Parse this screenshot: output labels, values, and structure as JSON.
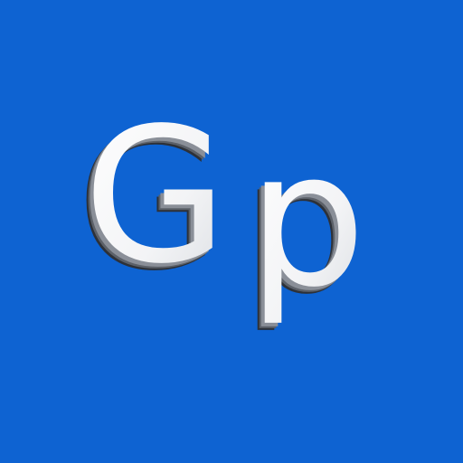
{
  "app_icon": {
    "name": "Gp",
    "letters": [
      "G",
      "p"
    ],
    "colors": {
      "background": "#0e63d2",
      "letter_face": "#f7f8fa",
      "letter_bevel_dark": "#3b3f46",
      "letter_bevel_mid": "#8a8f98"
    }
  }
}
